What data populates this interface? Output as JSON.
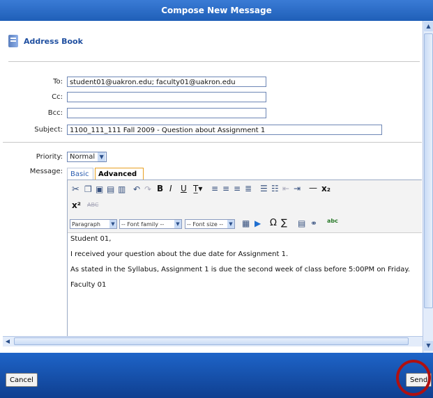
{
  "window": {
    "title": "Compose New Message"
  },
  "address_book": {
    "label": "Address Book"
  },
  "fields": {
    "to": {
      "label": "To:",
      "value": "student01@uakron.edu; faculty01@uakron.edu"
    },
    "cc": {
      "label": "Cc:",
      "value": ""
    },
    "bcc": {
      "label": "Bcc:",
      "value": ""
    },
    "subject": {
      "label": "Subject:",
      "value": "1100_111_111 Fall 2009 - Question about Assignment 1"
    },
    "priority": {
      "label": "Priority:",
      "value": "Normal"
    },
    "message": {
      "label": "Message:"
    }
  },
  "tabs": {
    "basic": "Basic",
    "advanced": "Advanced"
  },
  "toolbar": {
    "bold": "B",
    "italic": "I",
    "underline": "U",
    "strike": "ABC",
    "hr": "—",
    "subscript": "x₂",
    "superscript": "x²",
    "omega": "Ω",
    "sigma": "∑",
    "paragraph": "Paragraph",
    "font_family": "-- Font family --",
    "font_size": "-- Font size --",
    "spell": "abc"
  },
  "message_body": [
    "Student 01,",
    "I received your question about the due date for Assignment 1.",
    "As stated in the Syllabus, Assignment 1 is due the second week of class before 5:00PM on Friday.",
    "Faculty 01"
  ],
  "buttons": {
    "cancel": "Cancel",
    "send": "Send"
  },
  "colors": {
    "title_bar": "#2a6cc8",
    "bottom_bar": "#0f3f90",
    "highlight_circle": "#b01010"
  }
}
